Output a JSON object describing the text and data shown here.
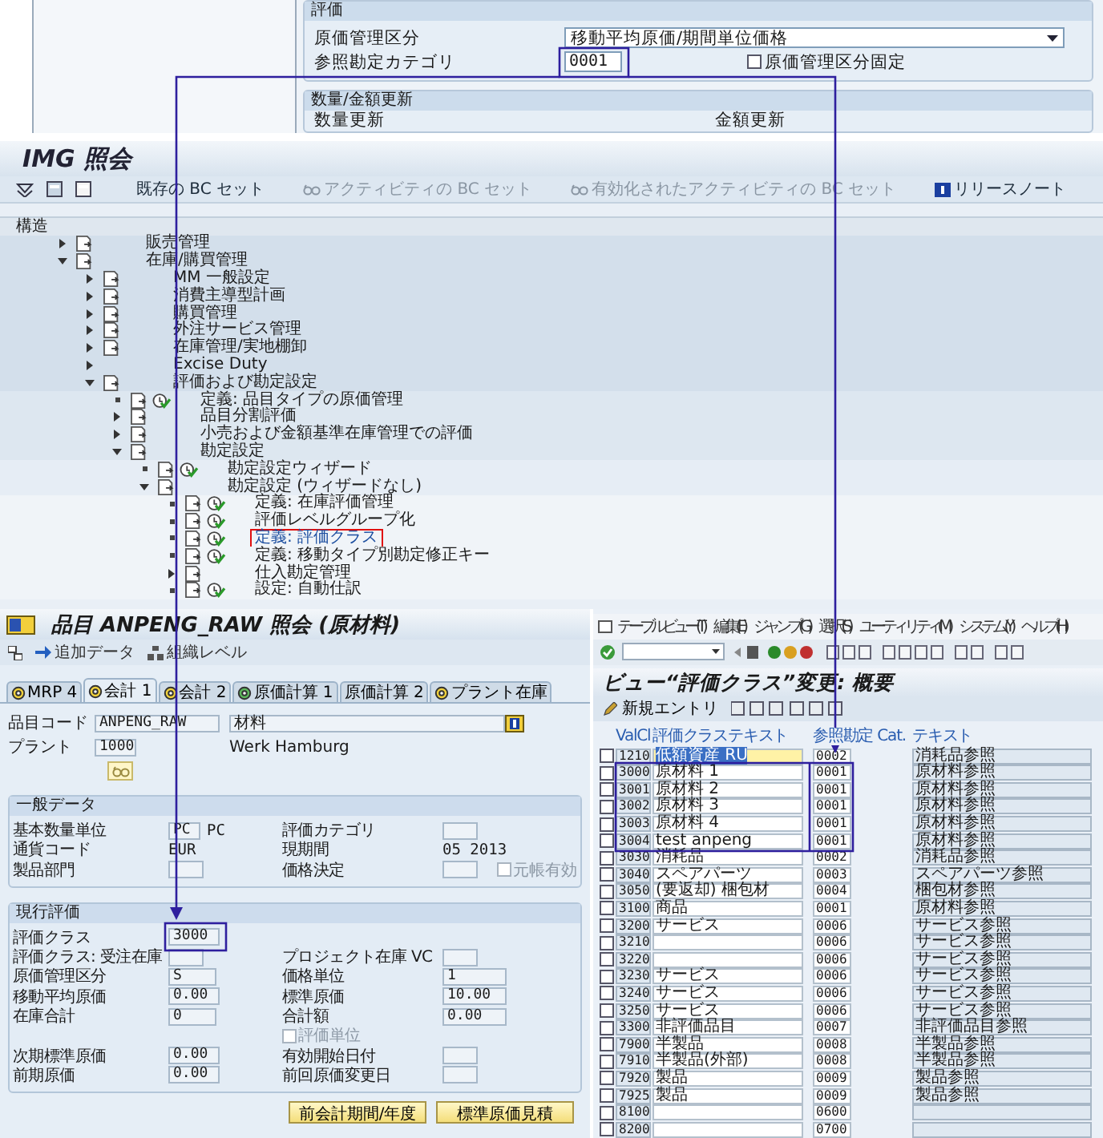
{
  "valuation_panel": {
    "title": "評価",
    "fields": [
      {
        "label": "原価管理区分",
        "value": "移動平均原価/期間単位価格",
        "kind": "dropdown"
      },
      {
        "label": "参照勘定カテゴリ",
        "value": "0001",
        "kind": "text"
      }
    ],
    "checkbox": {
      "label": "原価管理区分固定",
      "checked": false
    }
  },
  "quantity_panel": {
    "title": "数量/金額更新",
    "labels": [
      "数量更新",
      "金額更新"
    ]
  },
  "img_window": {
    "title": "IMG 照会",
    "toolbar": [
      {
        "label": "既存の BC セット",
        "disabled": false
      },
      {
        "label": "アクティビティの BC セット",
        "disabled": true
      },
      {
        "label": "有効化されたアクティビティの BC セット",
        "disabled": true
      },
      {
        "label": "リリースノート",
        "disabled": false
      }
    ],
    "structure_header": "構造",
    "tree": [
      {
        "label": "販売管理",
        "kind": "node",
        "expanded": false,
        "selected": false
      },
      {
        "label": "在庫/購買管理",
        "kind": "node",
        "expanded": true,
        "selected": false,
        "children": [
          {
            "label": "MM 一般設定",
            "kind": "node",
            "expanded": false,
            "selected": false
          },
          {
            "label": "消費主導型計画",
            "kind": "node",
            "expanded": false,
            "selected": false
          },
          {
            "label": "購買管理",
            "kind": "node",
            "expanded": false,
            "selected": false
          },
          {
            "label": "外注サービス管理",
            "kind": "node",
            "expanded": false,
            "selected": false
          },
          {
            "label": "在庫管理/実地棚卸",
            "kind": "node",
            "expanded": false,
            "selected": false
          },
          {
            "label": "Excise Duty",
            "kind": "plain",
            "expanded": false,
            "selected": false
          },
          {
            "label": "評価および勘定設定",
            "kind": "node",
            "expanded": true,
            "selected": false,
            "children": [
              {
                "label": "定義: 品目タイプの原価管理",
                "kind": "activity",
                "selected": false
              },
              {
                "label": "品目分割評価",
                "kind": "node",
                "expanded": false,
                "selected": false
              },
              {
                "label": "小売および金額基準在庫管理での評価",
                "kind": "node",
                "expanded": false,
                "selected": false
              },
              {
                "label": "勘定設定",
                "kind": "node",
                "expanded": true,
                "selected": false,
                "children": [
                  {
                    "label": "勘定設定ウィザード",
                    "kind": "activity",
                    "selected": false
                  },
                  {
                    "label": "勘定設定 (ウィザードなし)",
                    "kind": "node",
                    "expanded": true,
                    "selected": false,
                    "children": [
                      {
                        "label": "定義: 在庫評価管理",
                        "kind": "activity",
                        "selected": false
                      },
                      {
                        "label": "評価レベルグループ化",
                        "kind": "activity",
                        "selected": false
                      },
                      {
                        "label": "定義: 評価クラス",
                        "kind": "activity",
                        "selected": true
                      },
                      {
                        "label": "定義: 移動タイプ別勘定修正キー",
                        "kind": "activity",
                        "selected": false
                      },
                      {
                        "label": "仕入勘定管理",
                        "kind": "node",
                        "expanded": false,
                        "selected": false
                      },
                      {
                        "label": "設定: 自動仕訳",
                        "kind": "activity",
                        "selected": false
                      }
                    ]
                  }
                ]
              }
            ]
          }
        ]
      }
    ]
  },
  "material_window": {
    "title": "品目 ANPENG_RAW 照会 (原材料)",
    "toolbar": [
      "追加データ",
      "組織レベル"
    ],
    "tabs": [
      {
        "label": "MRP 4",
        "selected": false
      },
      {
        "label": "会計 1",
        "selected": true
      },
      {
        "label": "会計 2",
        "selected": false
      },
      {
        "label": "原価計算 1",
        "selected": false
      },
      {
        "label": "原価計算 2",
        "selected": false
      },
      {
        "label": "プラント在庫",
        "selected": false
      }
    ],
    "header_fields": [
      {
        "label": "品目コード",
        "value": "ANPENG_RAW",
        "description": "材料"
      },
      {
        "label": "プラント",
        "value": "1000",
        "description": "Werk Hamburg"
      }
    ],
    "sections": [
      {
        "title": "一般データ",
        "rows": [
          {
            "left": {
              "label": "基本数量単位",
              "value": "PC",
              "unit": "PC"
            },
            "right": {
              "label": "評価カテゴリ"
            }
          },
          {
            "left": {
              "label": "通貨コード",
              "value": "EUR",
              "kind": "plain"
            },
            "right": {
              "label": "現期間",
              "value": "05 2013",
              "kind": "plain"
            }
          },
          {
            "left": {
              "label": "製品部門"
            },
            "right": {
              "label": "価格決定"
            },
            "checkbox": {
              "label": "元帳有効",
              "checked": false,
              "disabled": true
            }
          }
        ]
      },
      {
        "title": "現行評価",
        "rows": [
          {
            "left": {
              "label": "評価クラス",
              "value": "3000"
            }
          },
          {
            "left": {
              "label": "評価クラス: 受注在庫"
            },
            "right": {
              "label": "プロジェクト在庫 VC"
            }
          },
          {
            "left": {
              "label": "原価管理区分",
              "value": "S"
            },
            "right": {
              "label": "価格単位",
              "value": "1"
            }
          },
          {
            "left": {
              "label": "移動平均原価",
              "value": "0.00"
            },
            "right": {
              "label": "標準原価",
              "value": "10.00"
            }
          },
          {
            "left": {
              "label": "在庫合計",
              "value": "0"
            },
            "right": {
              "label": "合計額",
              "value": "0.00"
            }
          },
          {
            "checkbox": {
              "label": "評価単位",
              "checked": false,
              "disabled": true
            }
          },
          {
            "left": {
              "label": "次期標準原価",
              "value": "0.00"
            },
            "right": {
              "label": "有効開始日付"
            }
          },
          {
            "left": {
              "label": "前期原価",
              "value": "0.00"
            },
            "right": {
              "label": "前回原価変更日"
            }
          }
        ]
      }
    ],
    "buttons": [
      "前会計期間/年度",
      "標準原価見積"
    ]
  },
  "table_window": {
    "menu": [
      "テーブルビュー(T)",
      "編集(E)",
      "ジャンプ(G)",
      "選択(S)",
      "ユーティリティ(M)",
      "システム(Y)",
      "ヘルプ(H)"
    ],
    "title": "ビュー“評価クラス”変更: 概要",
    "new_entries": "新規エントリ",
    "columns": [
      "ValCl",
      "評価クラステキスト",
      "参照勘定 Cat.",
      "テキスト"
    ],
    "rows": [
      {
        "valcl": "1210",
        "text": "低額資産 RU",
        "ref_cat": "0002",
        "ref_text": "消耗品参照",
        "selected": true,
        "checked": false
      },
      {
        "valcl": "3000",
        "text": "原材料 1",
        "ref_cat": "0001",
        "ref_text": "原材料参照",
        "selected": false,
        "checked": false
      },
      {
        "valcl": "3001",
        "text": "原材料 2",
        "ref_cat": "0001",
        "ref_text": "原材料参照",
        "selected": false,
        "checked": false
      },
      {
        "valcl": "3002",
        "text": "原材料 3",
        "ref_cat": "0001",
        "ref_text": "原材料参照",
        "selected": false,
        "checked": false
      },
      {
        "valcl": "3003",
        "text": "原材料 4",
        "ref_cat": "0001",
        "ref_text": "原材料参照",
        "selected": false,
        "checked": false
      },
      {
        "valcl": "3004",
        "text": "test anpeng",
        "ref_cat": "0001",
        "ref_text": "原材料参照",
        "selected": false,
        "checked": false
      },
      {
        "valcl": "3030",
        "text": "消耗品",
        "ref_cat": "0002",
        "ref_text": "消耗品参照",
        "selected": false,
        "checked": false
      },
      {
        "valcl": "3040",
        "text": "スペアパーツ",
        "ref_cat": "0003",
        "ref_text": "スペアパーツ参照",
        "selected": false,
        "checked": false
      },
      {
        "valcl": "3050",
        "text": "(要返却) 梱包材",
        "ref_cat": "0004",
        "ref_text": "梱包材参照",
        "selected": false,
        "checked": false
      },
      {
        "valcl": "3100",
        "text": "商品",
        "ref_cat": "0001",
        "ref_text": "原材料参照",
        "selected": false,
        "checked": false
      },
      {
        "valcl": "3200",
        "text": "サービス",
        "ref_cat": "0006",
        "ref_text": "サービス参照",
        "selected": false,
        "checked": false
      },
      {
        "valcl": "3210",
        "ref_cat": "0006",
        "ref_text": "サービス参照",
        "selected": false,
        "checked": false
      },
      {
        "valcl": "3220",
        "ref_cat": "0006",
        "ref_text": "サービス参照",
        "selected": false,
        "checked": false
      },
      {
        "valcl": "3230",
        "text": "サービス",
        "ref_cat": "0006",
        "ref_text": "サービス参照",
        "selected": false,
        "checked": false
      },
      {
        "valcl": "3240",
        "text": "サービス",
        "ref_cat": "0006",
        "ref_text": "サービス参照",
        "selected": false,
        "checked": false
      },
      {
        "valcl": "3250",
        "text": "サービス",
        "ref_cat": "0006",
        "ref_text": "サービス参照",
        "selected": false,
        "checked": false
      },
      {
        "valcl": "3300",
        "text": "非評価品目",
        "ref_cat": "0007",
        "ref_text": "非評価品目参照",
        "selected": false,
        "checked": false
      },
      {
        "valcl": "7900",
        "text": "半製品",
        "ref_cat": "0008",
        "ref_text": "半製品参照",
        "selected": false,
        "checked": false
      },
      {
        "valcl": "7910",
        "text": "半製品(外部)",
        "ref_cat": "0008",
        "ref_text": "半製品参照",
        "selected": false,
        "checked": false
      },
      {
        "valcl": "7920",
        "text": "製品",
        "ref_cat": "0009",
        "ref_text": "製品参照",
        "selected": false,
        "checked": false
      },
      {
        "valcl": "7925",
        "text": "製品",
        "ref_cat": "0009",
        "ref_text": "製品参照",
        "selected": false,
        "checked": false
      },
      {
        "valcl": "8100",
        "ref_cat": "0600",
        "selected": false,
        "checked": false
      },
      {
        "valcl": "8200",
        "ref_cat": "0700",
        "selected": false,
        "checked": false
      }
    ]
  }
}
